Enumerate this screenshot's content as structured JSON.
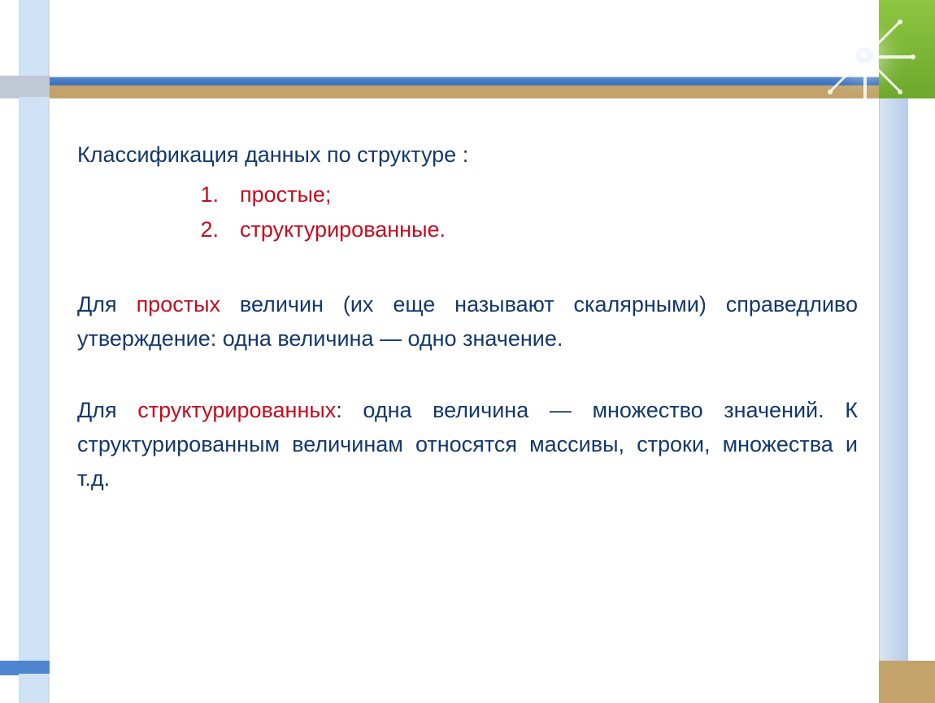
{
  "slide": {
    "heading": "Классификация данных по структуре :",
    "list": {
      "item1_num": "1.",
      "item1_text": "простые;",
      "item2_num": "2.",
      "item2_text": "структурированные."
    },
    "para1_prefix": "Для ",
    "para1_red": "простых",
    "para1_rest": " величин (их еще называют скалярными) справедливо утверждение: одна величина — одно значение.",
    "para2_prefix": "Для ",
    "para2_red": "структурированных",
    "para2_rest": ": одна величина — множество значений. К структурированным величинам относятся массивы, строки, множества и т.д."
  }
}
